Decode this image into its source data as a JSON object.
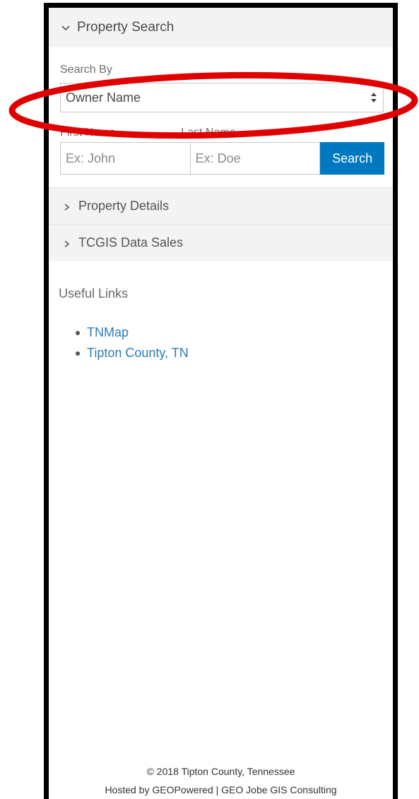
{
  "property_search": {
    "header": "Property Search",
    "search_by_label": "Search By",
    "search_by_value": "Owner Name",
    "first_name_label": "First Name",
    "last_name_label": "Last Name",
    "first_name_placeholder": "Ex: John",
    "last_name_placeholder": "Ex: Doe",
    "search_button": "Search"
  },
  "sections": {
    "property_details": "Property Details",
    "data_sales": "TCGIS Data Sales"
  },
  "useful_links": {
    "title": "Useful Links",
    "items": [
      "TNMap",
      "Tipton County, TN"
    ]
  },
  "footer": {
    "copyright": "© 2018 Tipton County, Tennessee",
    "hosted": "Hosted by GEOPowered | GEO Jobe GIS Consulting"
  },
  "colors": {
    "accent": "#0079c1",
    "link": "#2b7bbd",
    "annotation": "#e00000"
  }
}
